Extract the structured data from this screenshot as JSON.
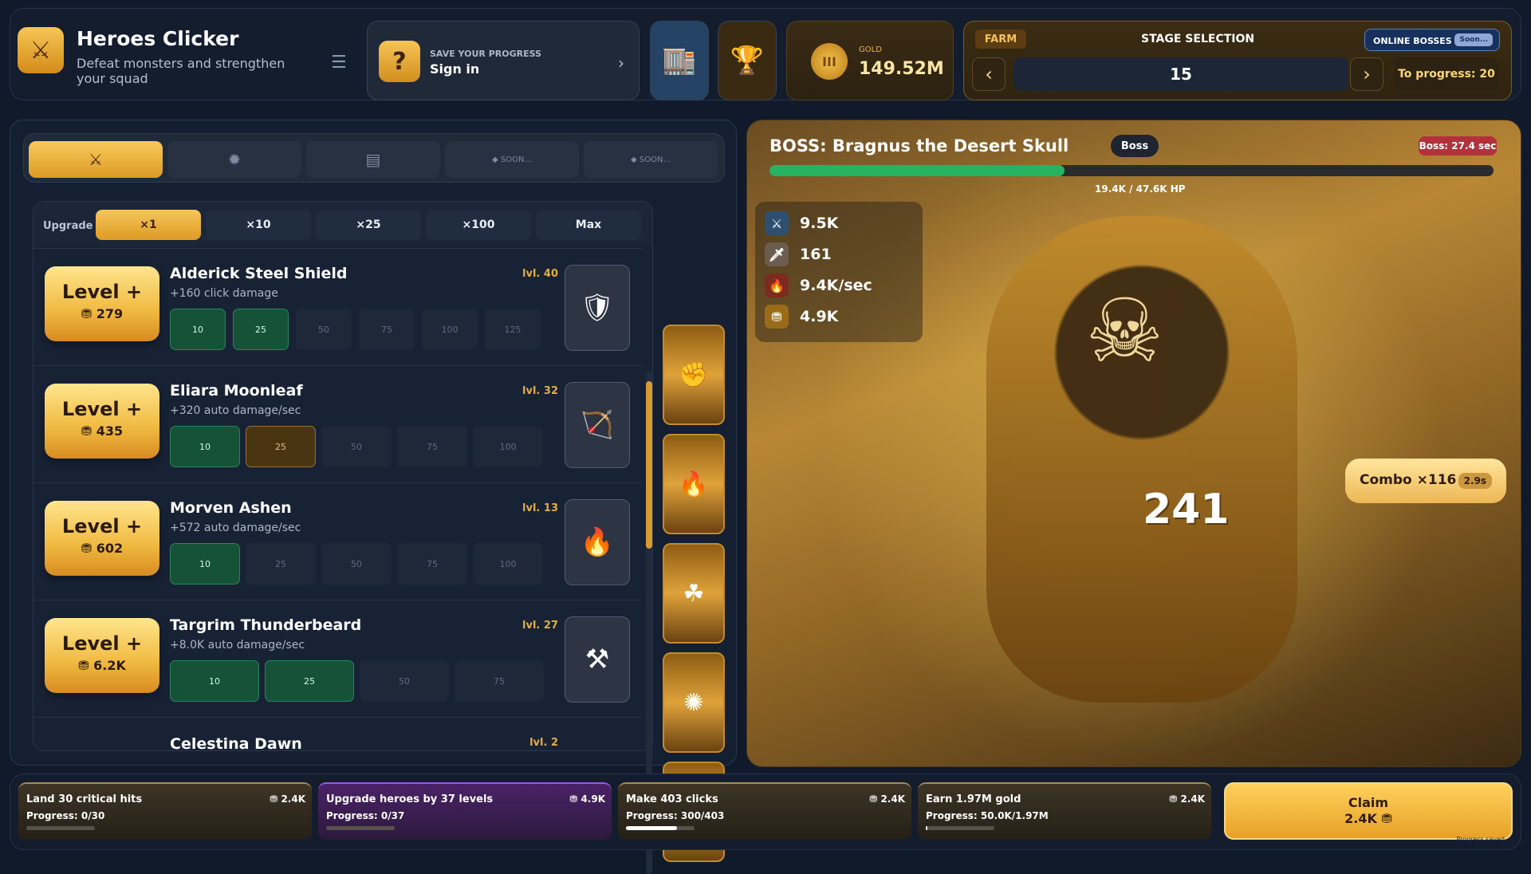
{
  "app": {
    "title": "Heroes Clicker",
    "subtitle": "Defeat monsters and strengthen your squad"
  },
  "signin": {
    "small": "SAVE YOUR PROGRESS",
    "label": "Sign in"
  },
  "gold": {
    "label": "GOLD",
    "value": "149.52M"
  },
  "stage": {
    "mode": "FARM",
    "title": "STAGE SELECTION",
    "online": "ONLINE BOSSES",
    "soon": "Soon...",
    "current": "15",
    "progress": "To progress: 20"
  },
  "tabs": [
    "⚔",
    "✹",
    "▤",
    "◆ SOON...",
    "◆ SOON..."
  ],
  "upgrade": {
    "label": "Upgrade",
    "options": [
      "×1",
      "×10",
      "×25",
      "×100",
      "Max"
    ]
  },
  "heroes": [
    {
      "name": "Alderick Steel Shield",
      "level": "lvl. 40",
      "desc": "+160 click damage",
      "cost": "279",
      "milestones": [
        "10",
        "25",
        "50",
        "75",
        "100",
        "125"
      ]
    },
    {
      "name": "Eliara Moonleaf",
      "level": "lvl. 32",
      "desc": "+320 auto damage/sec",
      "cost": "435",
      "milestones": [
        "10",
        "25",
        "50",
        "75",
        "100"
      ]
    },
    {
      "name": "Morven Ashen",
      "level": "lvl. 13",
      "desc": "+572 auto damage/sec",
      "cost": "602",
      "milestones": [
        "10",
        "25",
        "50",
        "75",
        "100"
      ]
    },
    {
      "name": "Targrim Thunderbeard",
      "level": "lvl. 27",
      "desc": "+8.0K auto damage/sec",
      "cost": "6.2K",
      "milestones": [
        "10",
        "25",
        "50",
        "75"
      ]
    },
    {
      "name": "Celestina Dawn",
      "level": "lvl. 2",
      "desc": "",
      "cost": "",
      "milestones": []
    }
  ],
  "level_label": "Level +",
  "boss": {
    "name": "BOSS: Bragnus the Desert Skull",
    "tag": "Boss",
    "timer": "Boss: 27.4 sec",
    "hp": "19.4K / 47.6K HP",
    "hp_fraction": 0.408
  },
  "stats": [
    {
      "icon": "sword-icon",
      "value": "9.5K"
    },
    {
      "icon": "dagger-icon",
      "value": "161"
    },
    {
      "icon": "fire-icon",
      "value": "9.4K/sec"
    },
    {
      "icon": "coin-icon",
      "value": "4.9K"
    }
  ],
  "combo": {
    "label": "Combo ×116",
    "time": "2.9s"
  },
  "damage": "241",
  "quests": [
    {
      "title": "Land 30 critical hits",
      "progress": "Progress: 0/30",
      "reward": "2.4K",
      "fraction": 0
    },
    {
      "title": "Upgrade heroes by 37 levels",
      "progress": "Progress: 0/37",
      "reward": "4.9K",
      "fraction": 0
    },
    {
      "title": "Make 403 clicks",
      "progress": "Progress: 300/403",
      "reward": "2.4K",
      "fraction": 0.744
    },
    {
      "title": "Earn 1.97M gold",
      "progress": "Progress: 50.0K/1.97M",
      "reward": "2.4K",
      "fraction": 0.025
    }
  ],
  "claim": {
    "label": "Claim",
    "amount": "2.4K"
  },
  "footer": "Progress saved"
}
